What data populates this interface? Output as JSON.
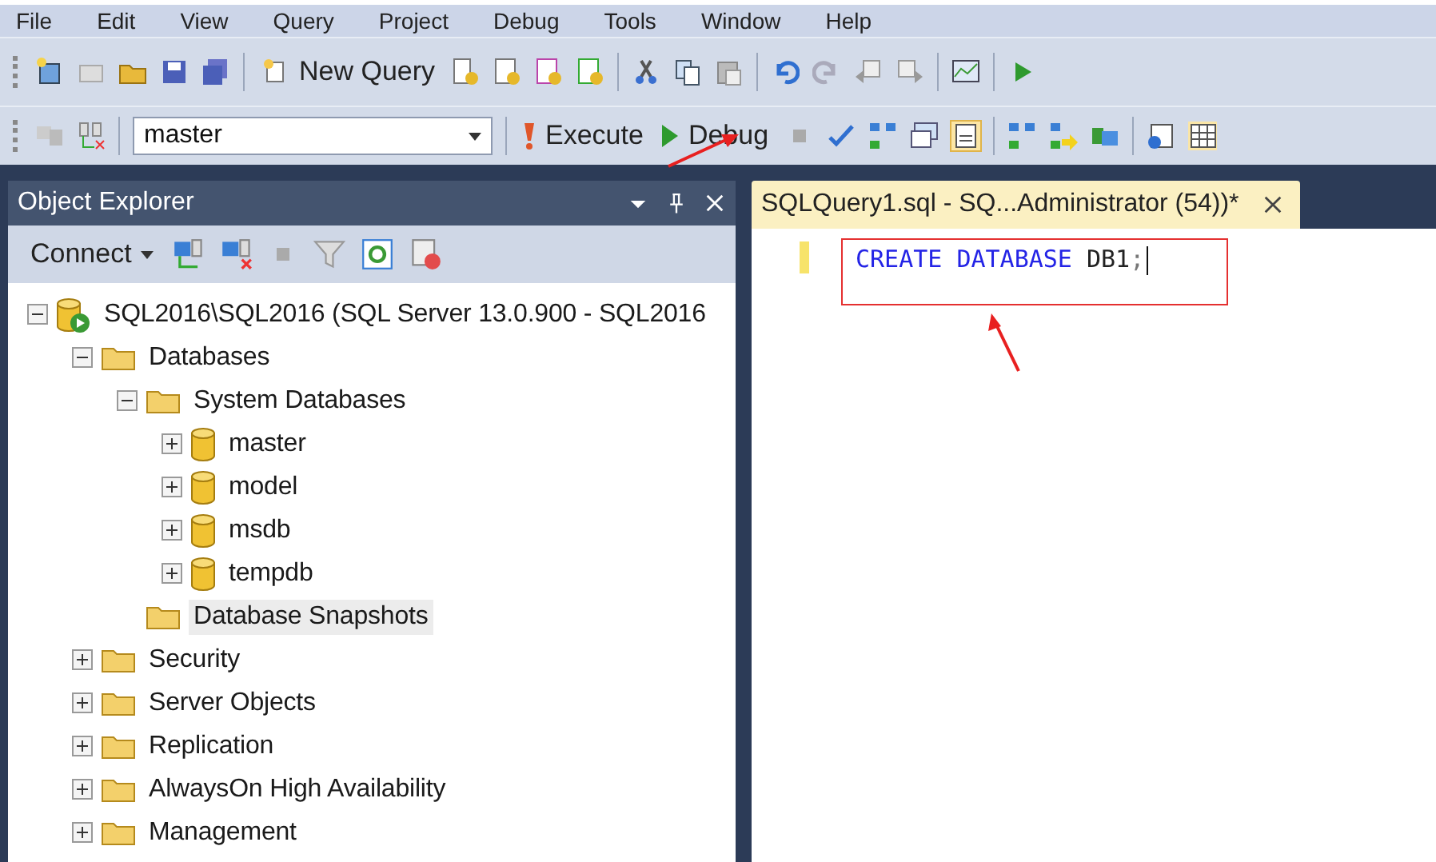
{
  "menu": [
    "File",
    "Edit",
    "View",
    "Query",
    "Project",
    "Debug",
    "Tools",
    "Window",
    "Help"
  ],
  "toolbar_standard": {
    "new_query": "New Query"
  },
  "toolbar_sql": {
    "database": "master",
    "execute": "Execute",
    "debug": "Debug"
  },
  "object_explorer": {
    "title": "Object Explorer",
    "connect": "Connect",
    "tree": [
      {
        "label": "SQL2016\\SQL2016 (SQL Server 13.0.900 - SQL2016",
        "kind": "server",
        "expandable": true,
        "expanded": true,
        "selected": false,
        "children": [
          {
            "label": "Databases",
            "kind": "folder",
            "expandable": true,
            "expanded": true,
            "selected": false,
            "children": [
              {
                "label": "System Databases",
                "kind": "folder",
                "expandable": true,
                "expanded": true,
                "selected": false,
                "children": [
                  {
                    "label": "master",
                    "kind": "database",
                    "expandable": true,
                    "expanded": false,
                    "selected": false
                  },
                  {
                    "label": "model",
                    "kind": "database",
                    "expandable": true,
                    "expanded": false,
                    "selected": false
                  },
                  {
                    "label": "msdb",
                    "kind": "database",
                    "expandable": true,
                    "expanded": false,
                    "selected": false
                  },
                  {
                    "label": "tempdb",
                    "kind": "database",
                    "expandable": true,
                    "expanded": false,
                    "selected": false
                  }
                ]
              },
              {
                "label": "Database Snapshots",
                "kind": "folder",
                "expandable": false,
                "selected": true
              }
            ]
          },
          {
            "label": "Security",
            "kind": "folder",
            "expandable": true,
            "expanded": false,
            "selected": false
          },
          {
            "label": "Server Objects",
            "kind": "folder",
            "expandable": true,
            "expanded": false,
            "selected": false
          },
          {
            "label": "Replication",
            "kind": "folder",
            "expandable": true,
            "expanded": false,
            "selected": false
          },
          {
            "label": "AlwaysOn High Availability",
            "kind": "folder",
            "expandable": true,
            "expanded": false,
            "selected": false
          },
          {
            "label": "Management",
            "kind": "folder",
            "expandable": true,
            "expanded": false,
            "selected": false
          }
        ]
      }
    ]
  },
  "editor": {
    "tab": "SQLQuery1.sql - SQ...Administrator (54))*",
    "code": [
      {
        "text": "CREATE",
        "kind": "keyword"
      },
      {
        "text": "DATABASE",
        "kind": "keyword"
      },
      {
        "text": "DB1",
        "kind": "name"
      },
      {
        "text": ";",
        "kind": "punct"
      }
    ]
  }
}
